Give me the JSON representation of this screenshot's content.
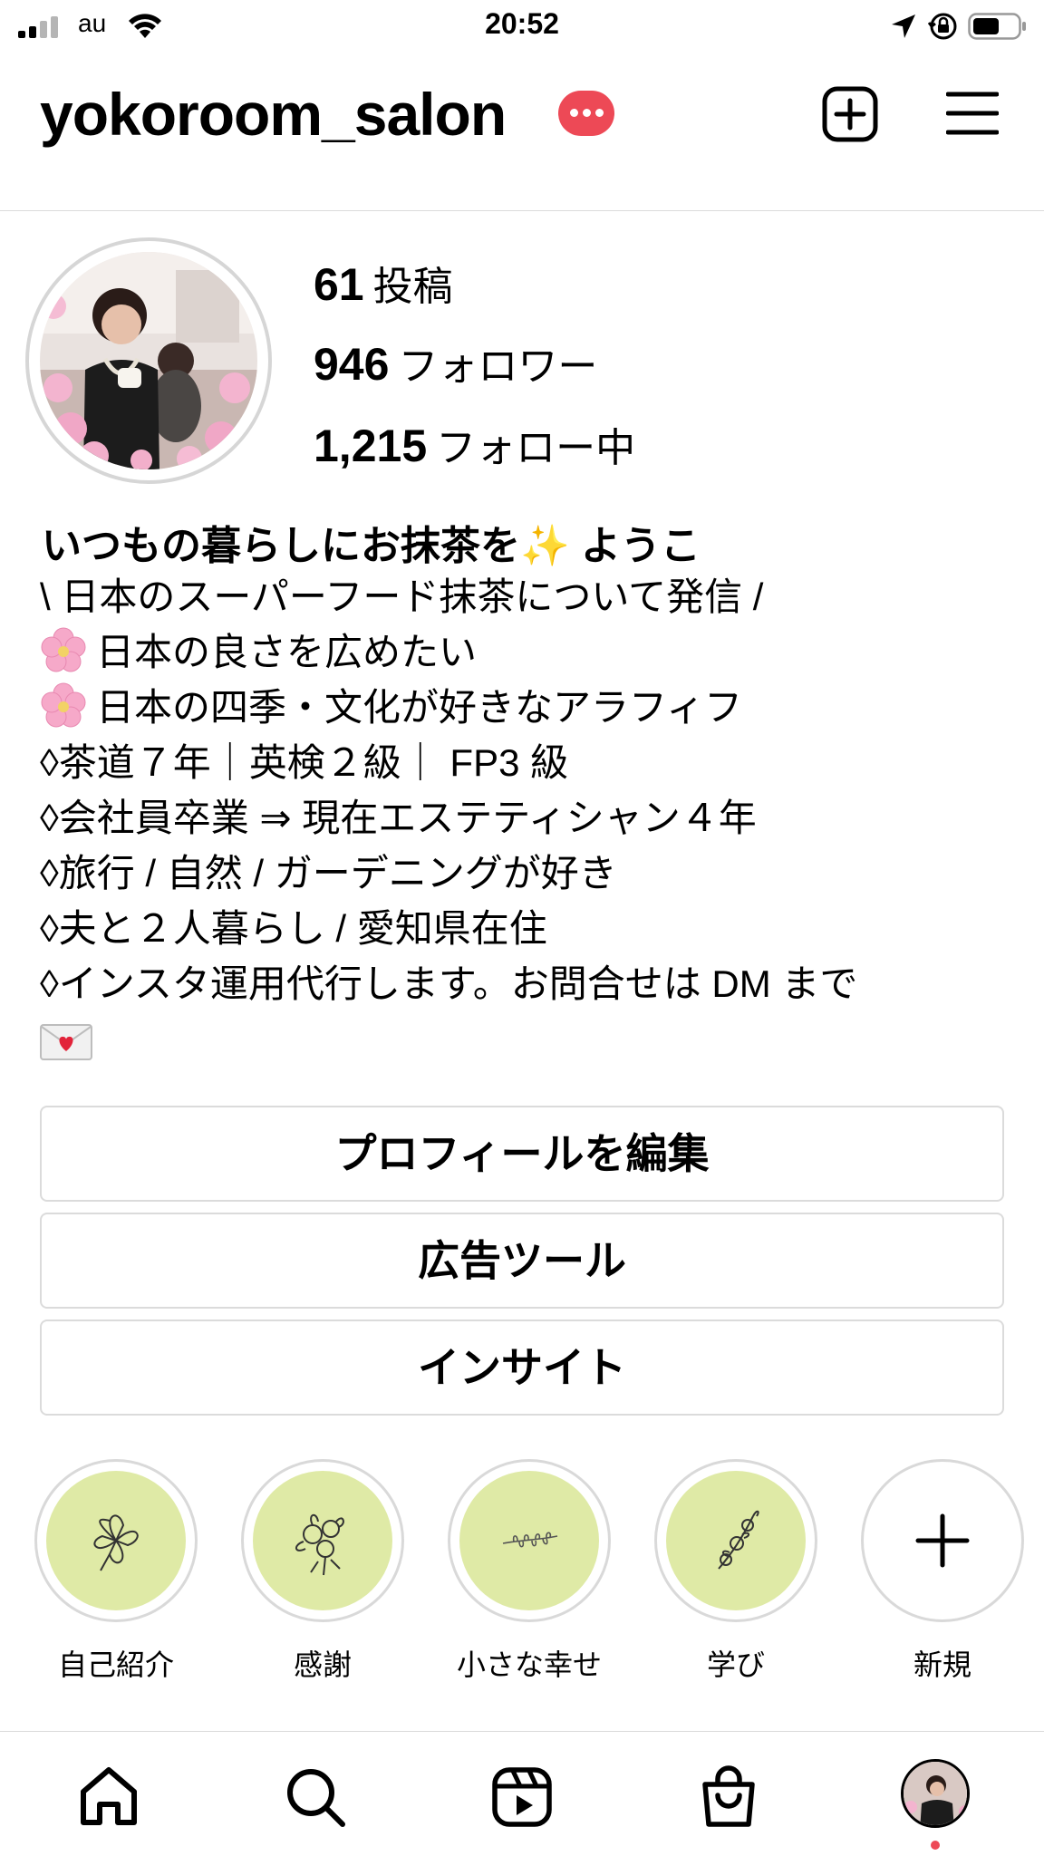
{
  "status_bar": {
    "carrier": "au",
    "time": "20:52"
  },
  "header": {
    "username": "yokoroom_salon",
    "icons": [
      "notification-badge-icon",
      "add-post-icon",
      "menu-icon"
    ]
  },
  "profile": {
    "stats": {
      "posts": {
        "count": "61",
        "label": "投稿"
      },
      "followers": {
        "count": "946",
        "label": "フォロワー"
      },
      "following": {
        "count": "1,215",
        "label": "フォロー中"
      }
    },
    "bio_name": "いつもの暮らしにお抹茶を✨ ようこ",
    "bio_lines": [
      "\\ 日本のスーパーフード抹茶について発信 /",
      "日本の良さを広めたい",
      "日本の四季・文化が好きなアラフィフ",
      "◊茶道７年｜英検２級｜ FP3 級",
      "◊会社員卒業 ⇒ 現在エステティシャン４年",
      "◊旅行 / 自然 / ガーデニングが好き",
      "◊夫と２人暮らし / 愛知県在住",
      "◊インスタ運用代行します。お問合せは DM まで"
    ]
  },
  "buttons": {
    "edit_profile": "プロフィールを編集",
    "ad_tools": "広告ツール",
    "insights": "インサイト"
  },
  "highlights": [
    {
      "label": "自己紹介"
    },
    {
      "label": "感謝"
    },
    {
      "label": "小さな幸せ"
    },
    {
      "label": "学び"
    },
    {
      "label": "新規"
    }
  ],
  "tabbar": [
    "home-icon",
    "search-icon",
    "reels-icon",
    "shop-icon",
    "profile-avatar"
  ],
  "colors": {
    "badge_red": "#ed4956",
    "highlight_green": "#dfeaa6",
    "divider": "#dbdbdb"
  }
}
